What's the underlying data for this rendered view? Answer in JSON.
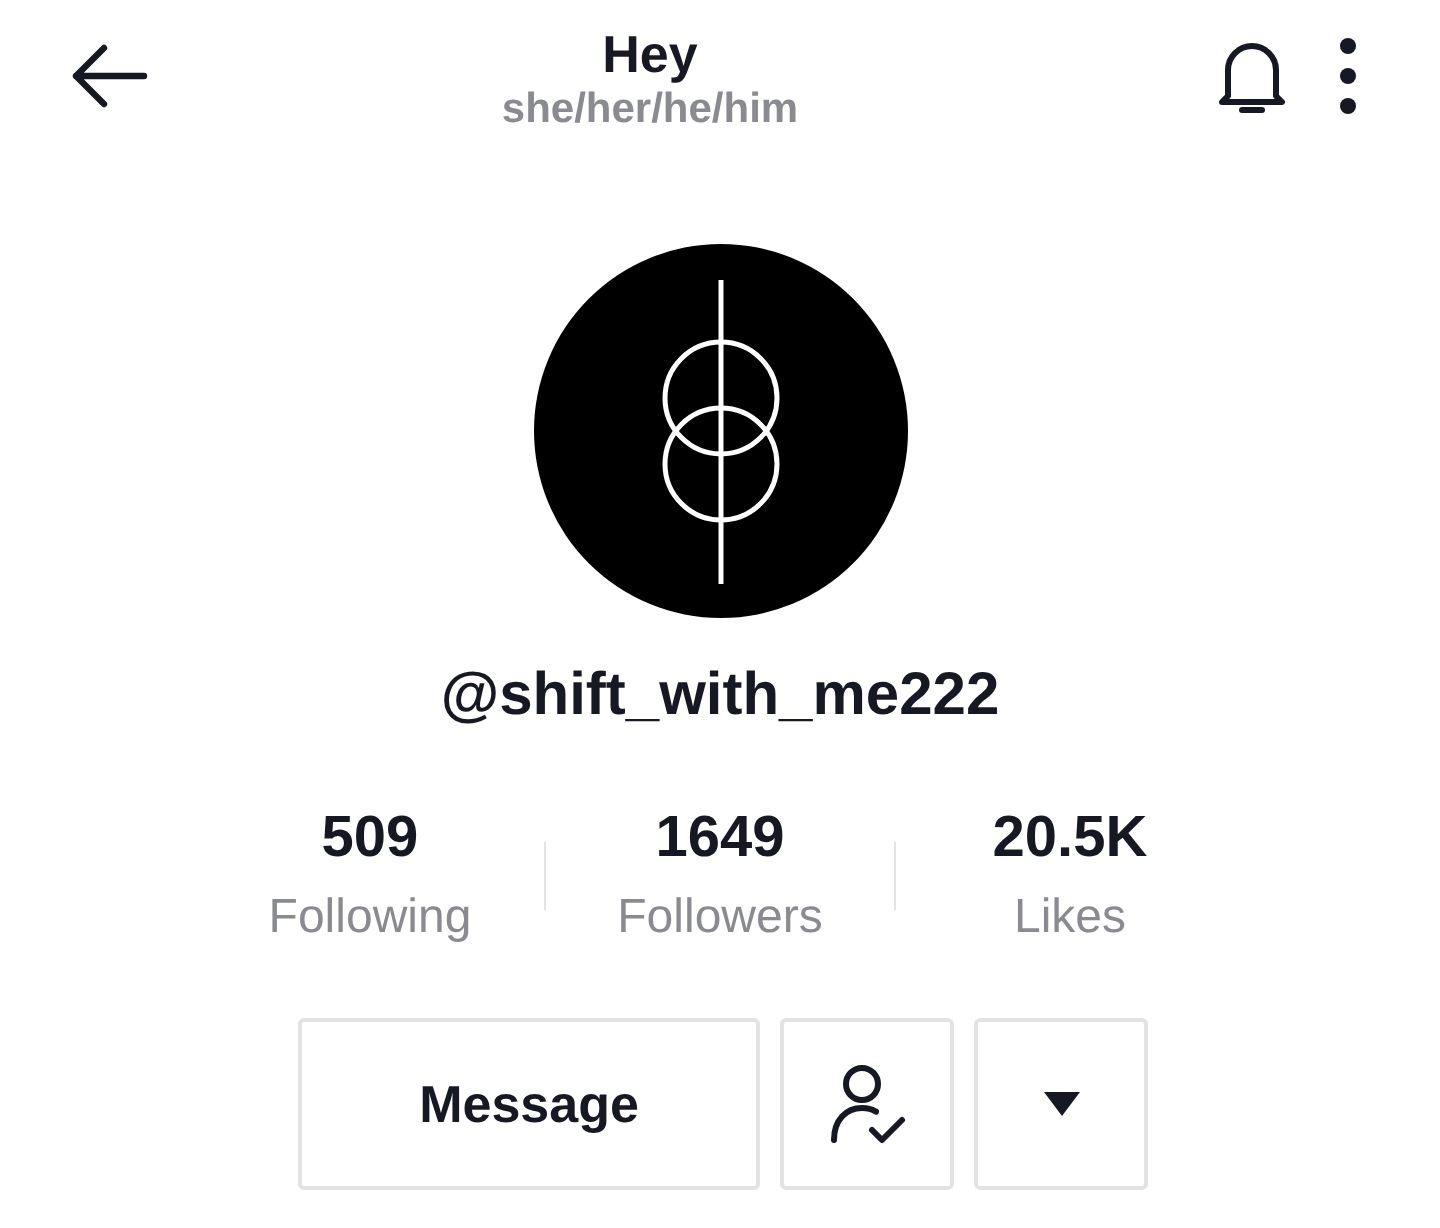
{
  "header": {
    "title": "Hey",
    "subtitle": "she/her/he/him"
  },
  "profile": {
    "username": "@shift_with_me222"
  },
  "stats": [
    {
      "value": "509",
      "label": "Following"
    },
    {
      "value": "1649",
      "label": "Followers"
    },
    {
      "value": "20.5K",
      "label": "Likes"
    }
  ],
  "actions": [
    {
      "kind": "text",
      "label": "Message"
    },
    {
      "kind": "follow-status"
    },
    {
      "kind": "dropdown"
    }
  ]
}
